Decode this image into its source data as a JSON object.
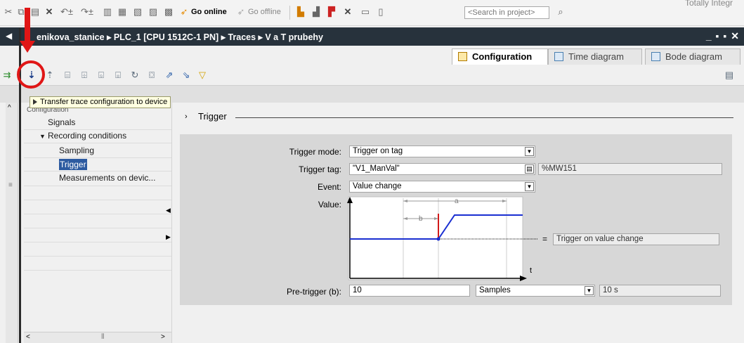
{
  "top_toolbar": {
    "go_online": "Go online",
    "go_offline": "Go offline",
    "search_placeholder": "<Search in project>",
    "corner_text": "Totally Integr"
  },
  "breadcrumb": {
    "items": [
      "enikova_stanice",
      "PLC_1 [CPU 1512C-1 PN]",
      "Traces",
      "V a T prubehy"
    ],
    "separator": "▸",
    "window_controls": "_ ▪ ▪ ✕"
  },
  "tabs": [
    {
      "label": "Configuration",
      "active": true
    },
    {
      "label": "Time diagram",
      "active": false
    },
    {
      "label": "Bode diagram",
      "active": false
    }
  ],
  "tooltip": {
    "text": "Transfer trace configuration to device"
  },
  "navigation": {
    "configuration_label": "Configuration",
    "signals": "Signals",
    "recording_conditions": "Recording conditions",
    "sampling": "Sampling",
    "trigger": "Trigger",
    "measurements": "Measurements on devic..."
  },
  "trigger_section": {
    "title": "Trigger",
    "trigger_mode_label": "Trigger mode:",
    "trigger_mode_value": "Trigger on tag",
    "trigger_tag_label": "Trigger tag:",
    "trigger_tag_value": "\"V1_ManVal\"",
    "trigger_tag_address": "%MW151",
    "event_label": "Event:",
    "event_value": "Value change",
    "value_label": "Value:",
    "condition_eq": "=",
    "condition_text": "Trigger on value change",
    "chart_labels": {
      "a": "a",
      "b": "b",
      "t": "t"
    },
    "pretrigger_label": "Pre-trigger (b):",
    "pretrigger_value": "10",
    "pretrigger_unit": "Samples",
    "pretrigger_time": "10 s"
  },
  "colors": {
    "breadcrumb_bg": "#27323c",
    "signal_line": "#1a2fd1",
    "trigger_marker": "#d11a1a",
    "annotation_red": "#e01616",
    "tooltip_bg": "#ffffe1"
  }
}
